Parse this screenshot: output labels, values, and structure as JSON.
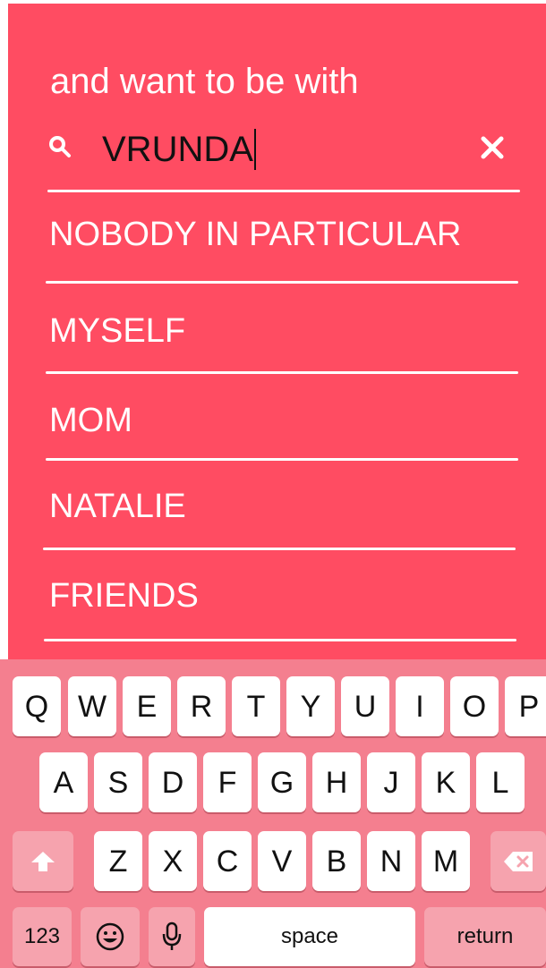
{
  "prompt": "and want to be with",
  "search": {
    "value": "VRUNDA",
    "icon": "search-icon",
    "clear_icon": "close-icon"
  },
  "options": [
    "NOBODY IN PARTICULAR",
    "MYSELF",
    "MOM",
    "NATALIE",
    "FRIENDS"
  ],
  "keyboard": {
    "row1": [
      "Q",
      "W",
      "E",
      "R",
      "T",
      "Y",
      "U",
      "I",
      "O",
      "P"
    ],
    "row2": [
      "A",
      "S",
      "D",
      "F",
      "G",
      "H",
      "J",
      "K",
      "L"
    ],
    "row3": [
      "Z",
      "X",
      "C",
      "V",
      "B",
      "N",
      "M"
    ],
    "numbers_label": "123",
    "space_label": "space",
    "return_label": "return",
    "shift_icon": "shift-icon",
    "delete_icon": "delete-icon",
    "emoji_icon": "emoji-icon",
    "mic_icon": "microphone-icon"
  },
  "colors": {
    "panel": "#ff4c62",
    "keyboard": "#f47f8f",
    "text": "#ffffff"
  }
}
